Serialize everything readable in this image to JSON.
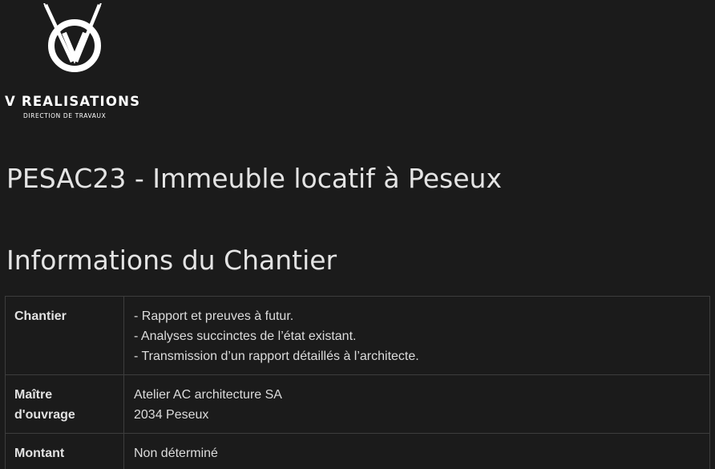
{
  "brand": {
    "name": "V REALISATIONS",
    "tagline": "DIRECTION DE TRAVAUX"
  },
  "project_title": "PESAC23 - Immeuble locatif à Peseux",
  "section_title": "Informations du Chantier",
  "table": {
    "rows": [
      {
        "label": "Chantier",
        "lines": [
          "- Rapport et preuves à futur.",
          "- Analyses succinctes de l’état existant.",
          "- Transmission d’un rapport détaillés à l’architecte."
        ]
      },
      {
        "label": "Maître d'ouvrage",
        "lines": [
          "Atelier AC architecture SA",
          "2034 Peseux"
        ]
      },
      {
        "label": "Montant",
        "lines": [
          "Non déterminé"
        ]
      }
    ]
  },
  "colors": {
    "background": "#1b1b1b",
    "text": "#dcdcdc",
    "border": "#3d3d3d",
    "logo": "#ffffff"
  }
}
